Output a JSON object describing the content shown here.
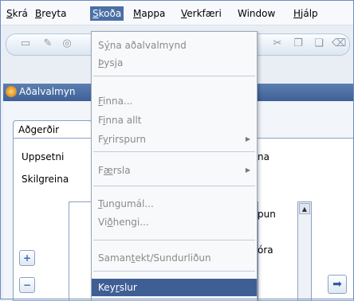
{
  "menubar": {
    "items": [
      {
        "label": "Skrá",
        "mn": "S",
        "rest": "krá"
      },
      {
        "label": "Breyta",
        "mn": "B",
        "rest": "reyta"
      },
      {
        "label": "Skoða",
        "mn": "S",
        "rest": "koða",
        "active": true
      },
      {
        "label": "Mappa",
        "mn": "M",
        "rest": "appa"
      },
      {
        "label": "Verkfæri",
        "mn": "V",
        "rest": "erkfæri"
      },
      {
        "label": "Window",
        "mn": "",
        "rest": "Window"
      },
      {
        "label": "Hjálp",
        "mn": "H",
        "rest": "jálp"
      }
    ]
  },
  "window": {
    "title": "Aðalvalmyn",
    "tab": "Aðgerðir",
    "labels": {
      "setup": "Uppsetni",
      "setup_tail": "na",
      "sep": "Skilgreina",
      "list_tail1": "pun",
      "list_tail2": "óra"
    }
  },
  "menu": {
    "items": [
      {
        "label": "Sýna aðalvalmynd",
        "pre": "S",
        "mn": "ý",
        "post": "na aðalvalmynd"
      },
      {
        "label": "Þysja",
        "pre": "",
        "mn": "Þ",
        "post": "ysja"
      },
      {
        "label": "Finna...",
        "pre": "",
        "mn": "F",
        "post": "inna..."
      },
      {
        "label": "Finna allt",
        "pre": "F",
        "mn": "i",
        "post": "nna allt"
      },
      {
        "label": "Fyrirspurn",
        "pre": "F",
        "mn": "y",
        "post": "rirspurn",
        "sub": true
      },
      {
        "label": "Færsla",
        "pre": "F",
        "mn": "æ",
        "post": "rsla",
        "sub": true
      },
      {
        "label": "Tungumál...",
        "pre": "",
        "mn": "T",
        "post": "ungumál..."
      },
      {
        "label": "Viðhengi...",
        "pre": "Vi",
        "mn": "ð",
        "post": "hengi..."
      },
      {
        "label": "Samantekt/Sundurliðun",
        "pre": "Saman",
        "mn": "t",
        "post": "ekt/Sundurliðun"
      },
      {
        "label": "Keyrslur",
        "pre": "Key",
        "mn": "r",
        "post": "slur",
        "selected": true
      }
    ]
  }
}
